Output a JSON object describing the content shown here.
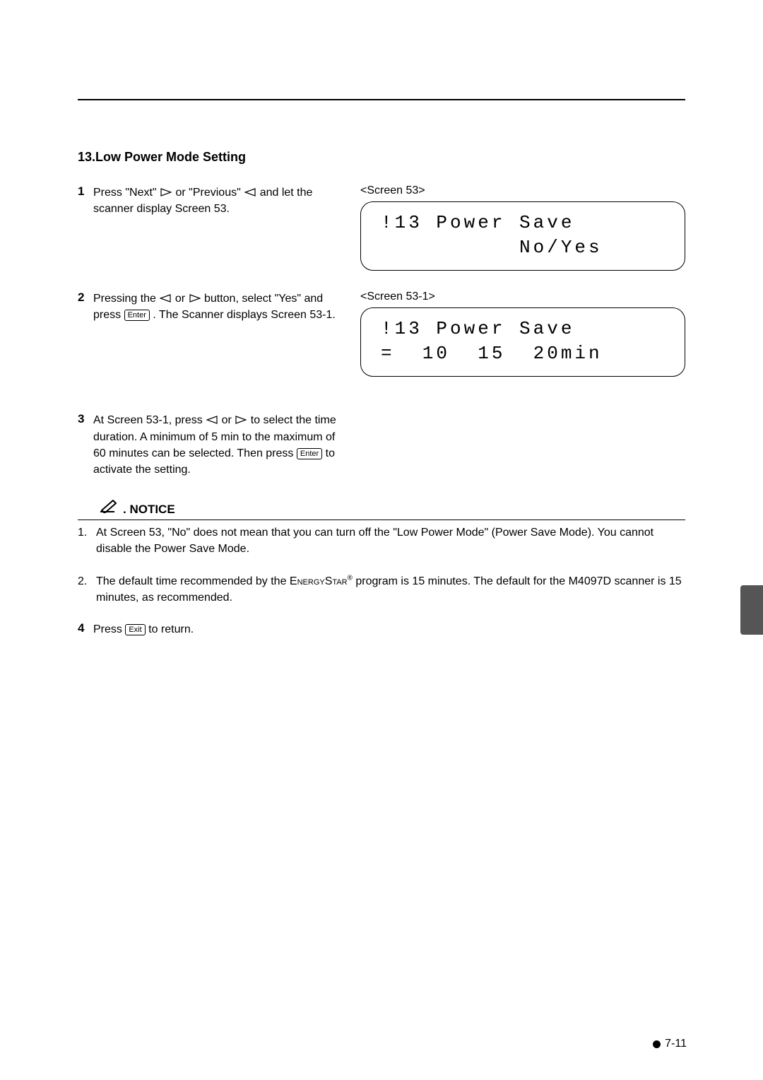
{
  "title": "13.Low Power Mode Setting",
  "steps": {
    "s1": {
      "num": "1",
      "pre": "Press \"Next\" ",
      "mid": " or \"Previous\" ",
      "post": " and let the scanner display Screen 53."
    },
    "s2": {
      "num": "2",
      "pre": "Pressing the ",
      "mid": " or ",
      "post1": " button, select \"Yes\" and press ",
      "key": "Enter",
      "post2": ". The Scanner displays Screen 53-1."
    },
    "s3": {
      "num": "3",
      "pre": "At Screen 53-1, press  ",
      "mid": " or ",
      "post1": " to select the time duration. A minimum of 5 min to the maximum of 60 minutes can be selected. Then press ",
      "key": "Enter",
      "post2": " to activate the setting."
    },
    "s4": {
      "num": "4",
      "pre": "Press ",
      "key": "Exit",
      "post": " to return."
    }
  },
  "screens": {
    "s53_label": "<Screen 53>",
    "s53_line1": "!13 Power Save",
    "s53_line2": "          No/Yes",
    "s531_label": "<Screen 53-1>",
    "s531_line1": "!13 Power Save",
    "s531_line2": "=  10  15  20min"
  },
  "notice": {
    "label": ". NOTICE",
    "n1_num": "1.",
    "n1_text": "At Screen 53, \"No\" does not mean that you can turn off the \"Low Power Mode\" (Power Save Mode). You cannot disable the Power Save Mode.",
    "n2_num": "2.",
    "n2_pre": "The default time recommended by the E",
    "n2_sc1": "nergy",
    "n2_mid": "S",
    "n2_sc2": "tar",
    "n2_sup": "®",
    "n2_post": " program is 15 minutes.  The default for the M4097D scanner is 15 minutes, as recommended."
  },
  "footer": "7-11"
}
